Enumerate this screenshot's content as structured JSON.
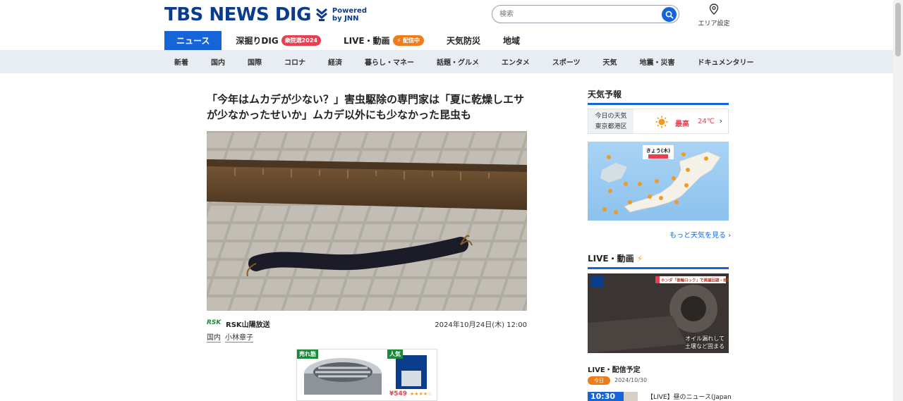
{
  "header": {
    "logo_text": "TBS NEWS DIG",
    "powered_line1": "Powered",
    "powered_line2": "by JNN",
    "search_placeholder": "検索",
    "area_label": "エリア設定"
  },
  "main_nav": [
    {
      "label": "ニュース",
      "active": true,
      "badge": ""
    },
    {
      "label": "深掘りDIG",
      "active": false,
      "badge": "衆院選2024"
    },
    {
      "label": "LIVE・動画",
      "active": false,
      "badge": "配信中"
    },
    {
      "label": "天気防災",
      "active": false,
      "badge": ""
    },
    {
      "label": "地域",
      "active": false,
      "badge": ""
    }
  ],
  "sub_nav": [
    "新着",
    "国内",
    "国際",
    "コロナ",
    "経済",
    "暮らし・マネー",
    "話題・グルメ",
    "エンタメ",
    "スポーツ",
    "天気",
    "地震・災害",
    "ドキュメンタリー"
  ],
  "article": {
    "title": "「今年はムカデが少ない？」害虫駆除の専門家は「夏に乾燥しエサが少なかったせいか」ムカデ以外にも少なかった昆虫も",
    "source_logo": "RSK",
    "source_name": "RSK山陽放送",
    "date": "2024年10月24日(木) 12:00",
    "tags": [
      "国内",
      "小林章子"
    ]
  },
  "ad": {
    "badge_left": "売れ筋",
    "badge_right": "人気",
    "price": "¥549",
    "stars": "★★★★☆"
  },
  "sidebar": {
    "weather_heading": "天気予報",
    "weather_label_line1": "今日の天気",
    "weather_label_line2": "東京都港区",
    "weather_high_label": "最高",
    "weather_high_temp": "24℃",
    "map_title": "きょう(木)",
    "more_weather": "もっと天気を見る",
    "live_heading": "LIVE・動画",
    "live_caption_line1": "オイル漏れして",
    "live_caption_line2": "土壌など固まる",
    "live_banner": "ホンダ「後輪ロック」で異議回避・修理へ",
    "schedule_heading": "LIVE・配信予定",
    "today_label": "今日",
    "today_date": "2024/10/30",
    "schedule_time": "10:30",
    "schedule_show": "【LIVE】昼のニュース(Japan"
  },
  "colors": {
    "brand_blue": "#1665d8",
    "logo_navy": "#0a3c8c",
    "badge_red": "#e8404e",
    "badge_orange": "#ef7c1b",
    "subnav_bg": "#e8edf3"
  }
}
